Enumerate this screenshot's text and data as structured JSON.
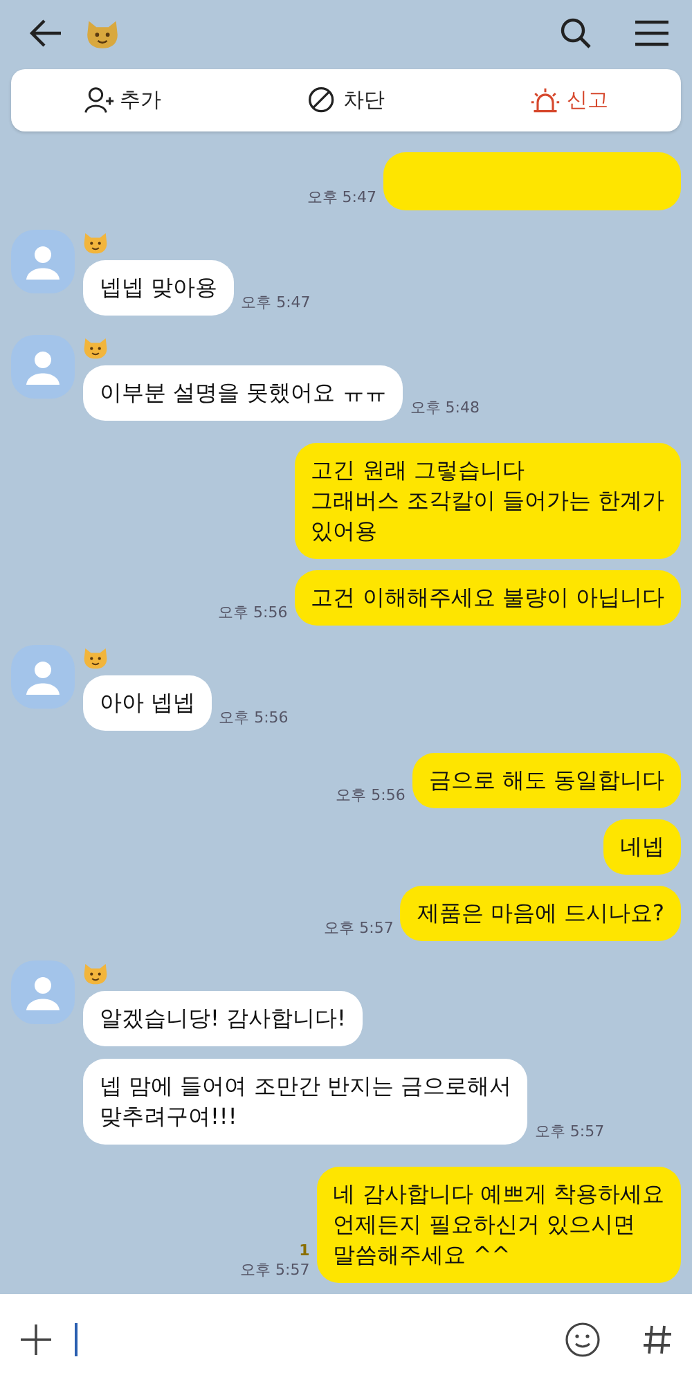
{
  "actions": [
    {
      "kind": "add",
      "label": "추가"
    },
    {
      "kind": "block",
      "label": "차단"
    },
    {
      "kind": "report",
      "label": "신고"
    }
  ],
  "messages": [
    {
      "kind": "partial",
      "time": "오후 5:47"
    },
    {
      "kind": "received",
      "avatar": true,
      "text": "넵넵 맞아용",
      "time": "오후 5:47"
    },
    {
      "kind": "received",
      "avatar": true,
      "text": "이부분 설명을 못했어요 ㅠㅠ",
      "time": "오후 5:48"
    },
    {
      "kind": "sent",
      "text": "고긴 원래 그렇습니다\n그래버스 조각칼이 들어가는 한계가\n있어용"
    },
    {
      "kind": "sent",
      "text": "고건 이해해주세요 불량이 아닙니다",
      "time": "오후 5:56"
    },
    {
      "kind": "received",
      "avatar": true,
      "text": "아아 넵넵",
      "time": "오후 5:56"
    },
    {
      "kind": "sent",
      "text": "금으로 해도 동일합니다",
      "time": "오후 5:56"
    },
    {
      "kind": "sent",
      "text": "네넵"
    },
    {
      "kind": "sent",
      "text": "제품은 마음에 드시나요?",
      "time": "오후 5:57"
    },
    {
      "kind": "received",
      "avatar": true,
      "text": "알겠습니당! 감사합니다!"
    },
    {
      "kind": "received",
      "avatar": false,
      "text": "넵 맘에 들어여 조만간 반지는 금으로해서\n맞추려구여!!!",
      "time": "오후 5:57"
    },
    {
      "kind": "sent",
      "text": "네 감사합니다 예쁘게 착용하세요\n언제든지 필요하신거 있으시면\n말씀해주세요 ^^",
      "unread": "1",
      "time": "오후 5:57"
    }
  ]
}
